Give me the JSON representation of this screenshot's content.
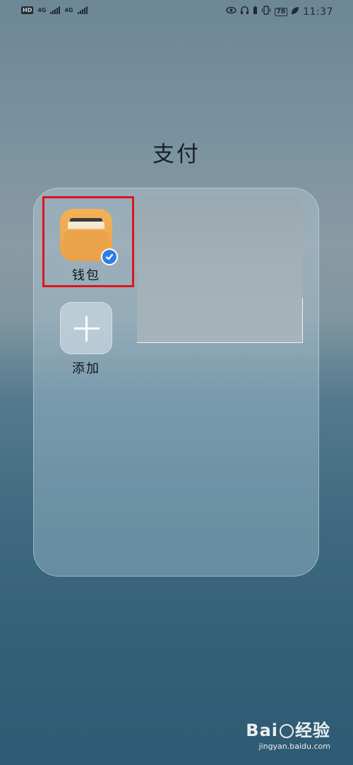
{
  "status_bar": {
    "hd_badge": "HD",
    "network_1": "4G",
    "network_2": "4G",
    "battery": "78",
    "time": "11:37",
    "icons": [
      "eye-icon",
      "headphones-icon",
      "vibrate-icon",
      "battery-icon",
      "leaf-icon"
    ]
  },
  "folder": {
    "title": "支付",
    "apps": [
      {
        "label": "钱包",
        "icon": "wallet-icon",
        "badge": "verified-check-icon"
      },
      {
        "label": "添加",
        "icon": "plus-icon"
      }
    ]
  },
  "watermark": {
    "brand_left": "Bai",
    "brand_right": "经验",
    "url": "jingyan.baidu.com"
  },
  "colors": {
    "highlight": "#e0141c",
    "wallet_orange": "#f3b257",
    "badge_blue": "#2f7de8"
  }
}
